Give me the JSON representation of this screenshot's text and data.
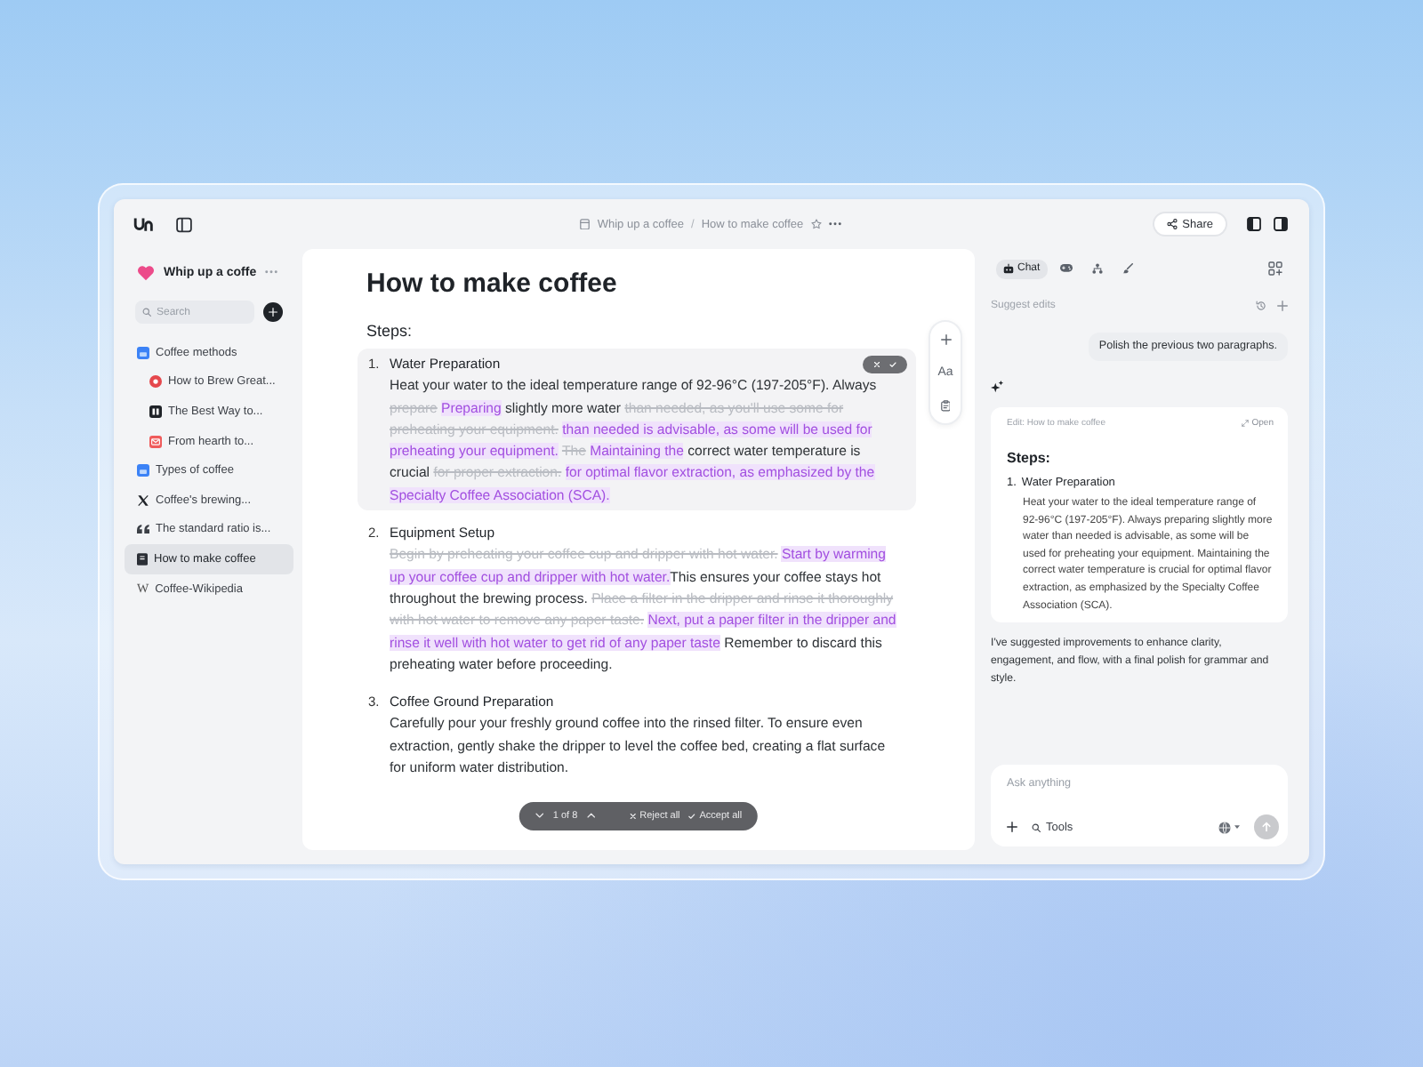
{
  "topbar": {
    "breadcrumb": {
      "parent": "Whip up a coffee",
      "separator": "/",
      "current": "How to make coffee"
    },
    "share": "Share"
  },
  "sidebar": {
    "workspace": "Whip up a coffe",
    "search": {
      "placeholder": "Search"
    },
    "items": [
      {
        "label": "Coffee methods",
        "kind": "folder",
        "selected": false,
        "children": [
          {
            "label": "How to Brew Great...",
            "kind": "video",
            "selected": false
          },
          {
            "label": "The Best Way to...",
            "kind": "tile",
            "selected": false
          },
          {
            "label": "From hearth to...",
            "kind": "mail",
            "selected": false
          }
        ]
      },
      {
        "label": "Types of coffee",
        "kind": "folder",
        "selected": false
      },
      {
        "label": "Coffee's brewing...",
        "kind": "x",
        "selected": false
      },
      {
        "label": "The standard ratio is...",
        "kind": "quote",
        "selected": false
      },
      {
        "label": "How to make coffee",
        "kind": "doc",
        "selected": true
      },
      {
        "label": "Coffee-Wikipedia",
        "kind": "glyph",
        "glyph": "W",
        "selected": false
      }
    ]
  },
  "document": {
    "title": "How to make coffee",
    "subtitle": "Steps:",
    "toolbar": {
      "format": "Aa"
    },
    "steps": [
      {
        "number": "1.",
        "heading": "Water Preparation",
        "focused": true,
        "segments": [
          {
            "kind": "plain",
            "text": "Heat your water to the ideal temperature range of 92-96°C (197-205°F). Always"
          },
          {
            "kind": "deleted",
            "text": "prepare"
          },
          {
            "kind": "inserted",
            "text": "Preparing"
          },
          {
            "kind": "plain",
            "text": "slightly more water"
          },
          {
            "kind": "deleted",
            "text": "than needed, as you'll use some for preheating your equipment."
          },
          {
            "kind": "inserted",
            "text": "than needed is advisable, as some will be used for preheating your equipment."
          },
          {
            "kind": "deleted",
            "text": "The"
          },
          {
            "kind": "inserted",
            "text": "Maintaining the"
          },
          {
            "kind": "plain",
            "text": "correct water temperature is crucial"
          },
          {
            "kind": "deleted",
            "text": "for proper extraction."
          },
          {
            "kind": "inserted",
            "text": "for optimal flavor extraction, as emphasized by the Specialty Coffee Association (SCA)."
          }
        ]
      },
      {
        "number": "2.",
        "heading": "Equipment Setup",
        "focused": false,
        "segments": [
          {
            "kind": "deleted",
            "text": "Begin by preheating your coffee cup and dripper with hot water."
          },
          {
            "kind": "inserted",
            "text": "Start by warming up your coffee cup and dripper with hot water."
          },
          {
            "kind": "plain",
            "attached": true,
            "text": "This ensures your coffee stays hot throughout the brewing process."
          },
          {
            "kind": "deleted",
            "text": "Place a filter in the dripper and rinse it thoroughly with hot water to remove any paper taste."
          },
          {
            "kind": "inserted",
            "text": "Next, put a paper filter in the dripper and rinse it well with hot water to get rid of any paper taste"
          },
          {
            "kind": "plain",
            "text": "Remember to discard this preheating water before proceeding."
          }
        ]
      },
      {
        "number": "3.",
        "heading": "Coffee Ground Preparation",
        "focused": false,
        "segments": [
          {
            "kind": "plain",
            "text": "Carefully pour your freshly ground coffee into the rinsed filter. To ensure even extraction, gently shake the dripper to level the coffee bed, creating a flat surface for uniform water distribution."
          }
        ]
      }
    ],
    "review": {
      "counter": "1 of 8",
      "reject": "Reject all",
      "accept": "Accept all"
    }
  },
  "assistant": {
    "tabs": [
      {
        "label": "Chat",
        "kind": "chat",
        "selected": true
      },
      {
        "kind": "gamepad",
        "selected": false
      },
      {
        "kind": "hierarchy",
        "selected": false
      },
      {
        "kind": "brush",
        "selected": false
      }
    ],
    "mode": "Suggest edits",
    "messages": [
      {
        "kind": "user",
        "text": "Polish the previous two paragraphs."
      },
      {
        "kind": "edit",
        "header": "Edit: How to make coffee",
        "open": "Open",
        "heading": "Steps:",
        "number": "1.",
        "step": "Water Preparation",
        "body": "Heat your water to the ideal temperature range of 92-96°C (197-205°F). Always preparing slightly more water than needed is advisable, as some will be used for preheating your equipment. Maintaining the correct water temperature is crucial for optimal flavor extraction, as emphasized by the Specialty Coffee Association (SCA)."
      },
      {
        "kind": "reply",
        "text": "I've suggested improvements to enhance clarity, engagement, and flow, with a final polish for grammar and style."
      }
    ],
    "input": {
      "placeholder": "Ask anything",
      "tools": "Tools"
    }
  }
}
